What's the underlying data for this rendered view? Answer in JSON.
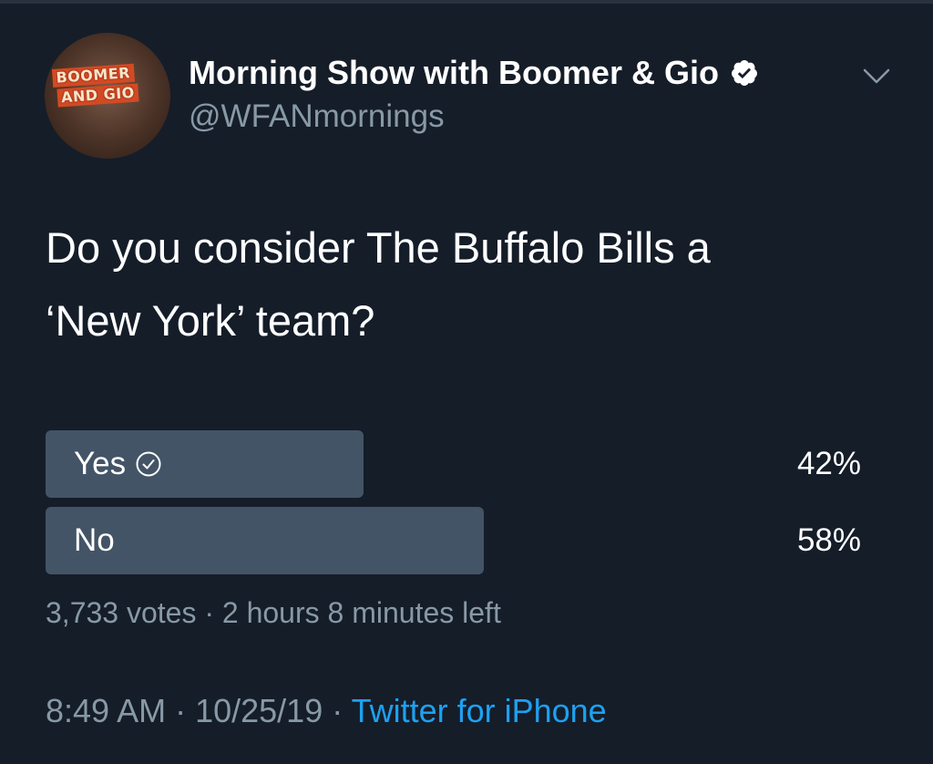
{
  "header": {
    "display_name": "Morning Show with Boomer & Gio",
    "handle": "@WFANmornings",
    "avatar_text": [
      "BOOMER",
      "AND GIO"
    ]
  },
  "tweet": {
    "text_line1": "Do you consider The Buffalo Bills a",
    "text_line2": "‘New York’ team?"
  },
  "poll": {
    "options": [
      {
        "label": "Yes",
        "percent_text": "42%",
        "value": 0.42,
        "selected": true
      },
      {
        "label": "No",
        "percent_text": "58%",
        "value": 0.58,
        "selected": false
      }
    ],
    "votes": "3,733 votes",
    "separator": " · ",
    "time_left": "2 hours 8 minutes left"
  },
  "footer": {
    "time": "8:49 AM",
    "separator": " · ",
    "date": "10/25/19",
    "source": "Twitter for iPhone"
  },
  "colors": {
    "background": "#151d29",
    "poll_bar": "#435466",
    "secondary_text": "#8899a6",
    "link": "#1da1f2"
  }
}
